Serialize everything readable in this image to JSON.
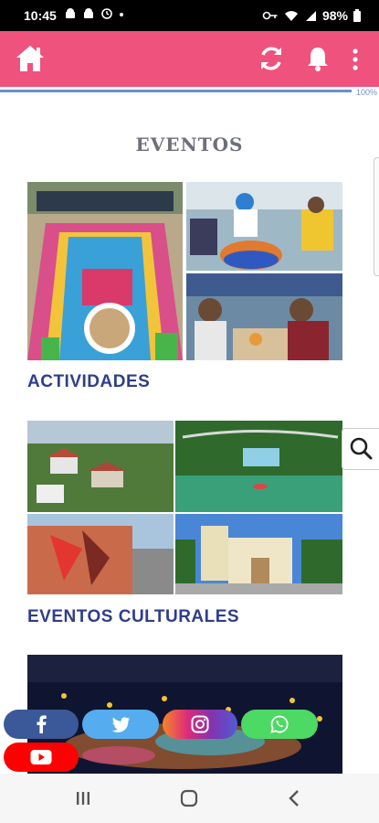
{
  "status_bar": {
    "time": "10:45",
    "battery": "98%"
  },
  "app_bar": {
    "home_icon": "home-icon",
    "refresh_icon": "refresh-icon",
    "bell_icon": "bell-icon",
    "more_icon": "more-vert-icon",
    "color": "#f0527e"
  },
  "progress": {
    "label": "100%",
    "value": 1.0
  },
  "page": {
    "title": "EVENTOS"
  },
  "sections": [
    {
      "label": "ACTIVIDADES"
    },
    {
      "label": "EVENTOS CULTURALES"
    }
  ],
  "social": [
    {
      "name": "facebook",
      "icon": "facebook-icon",
      "color": "#3b5998"
    },
    {
      "name": "twitter",
      "icon": "twitter-icon",
      "color": "#55acee"
    },
    {
      "name": "instagram",
      "icon": "instagram-icon",
      "color": "#e1306c"
    },
    {
      "name": "whatsapp",
      "icon": "whatsapp-icon",
      "color": "#4cd964"
    },
    {
      "name": "youtube",
      "icon": "youtube-icon",
      "color": "#ff0000"
    }
  ],
  "colors": {
    "accent": "#f0527e",
    "section_text": "#2e3e8a",
    "title_text": "#6d6f7a"
  }
}
